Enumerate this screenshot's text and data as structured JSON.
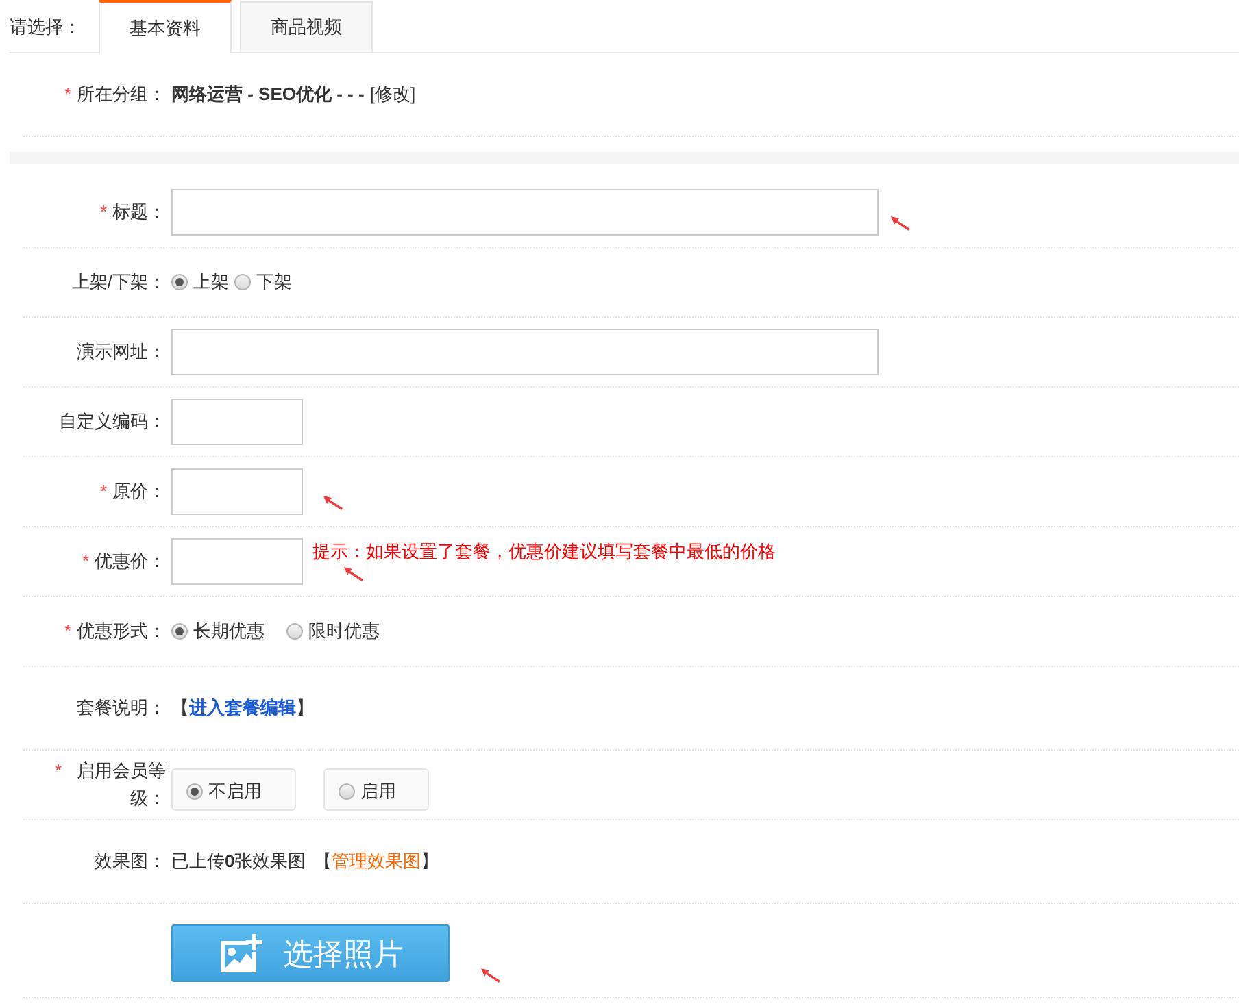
{
  "tabs_label": "请选择：",
  "tabs": [
    {
      "label": "基本资料",
      "selected": true
    },
    {
      "label": "商品视频",
      "selected": false
    }
  ],
  "group": {
    "mark": "*",
    "label": "所在分组：",
    "value": "网络运营 - SEO优化 - - -",
    "link": "[修改]"
  },
  "fields": [
    {
      "kind": "input",
      "mark": "*",
      "label": "标题：",
      "wide": true,
      "arrow": true
    },
    {
      "kind": "radio",
      "label": "上架/下架：",
      "options": [
        {
          "label": "上架",
          "selected": true
        },
        {
          "label": "下架",
          "selected": false
        }
      ]
    },
    {
      "kind": "input",
      "label": "演示网址：",
      "wide": true
    },
    {
      "kind": "input",
      "label": "自定义编码：",
      "wide": false
    },
    {
      "kind": "input",
      "mark": "*",
      "label": "原价：",
      "wide": false,
      "arrow": true
    },
    {
      "kind": "input",
      "mark": "*",
      "label": "优惠价：",
      "wide": false,
      "arrow": true,
      "hint": "提示：如果设置了套餐，优惠价建议填写套餐中最低的价格"
    },
    {
      "kind": "radio",
      "mark": "*",
      "label": "优惠形式：",
      "options": [
        {
          "label": "长期优惠",
          "selected": true
        },
        {
          "label": "限时优惠",
          "selected": false
        }
      ]
    },
    {
      "kind": "link",
      "label": "套餐说明：",
      "before": "【",
      "link": "进入套餐编辑",
      "after": "】"
    },
    {
      "kind": "boxed_radio",
      "mark": "*",
      "label": "启用会员等级：",
      "options": [
        {
          "label": "不启用",
          "selected": true
        },
        {
          "label": "启用",
          "selected": false
        }
      ]
    },
    {
      "kind": "info",
      "label": "效果图：",
      "text": "已上传**0**张效果图",
      "before": "【",
      "link": "管理效果图",
      "after": "】"
    },
    {
      "kind": "upload",
      "button": "选择照片",
      "arrow": true
    }
  ]
}
